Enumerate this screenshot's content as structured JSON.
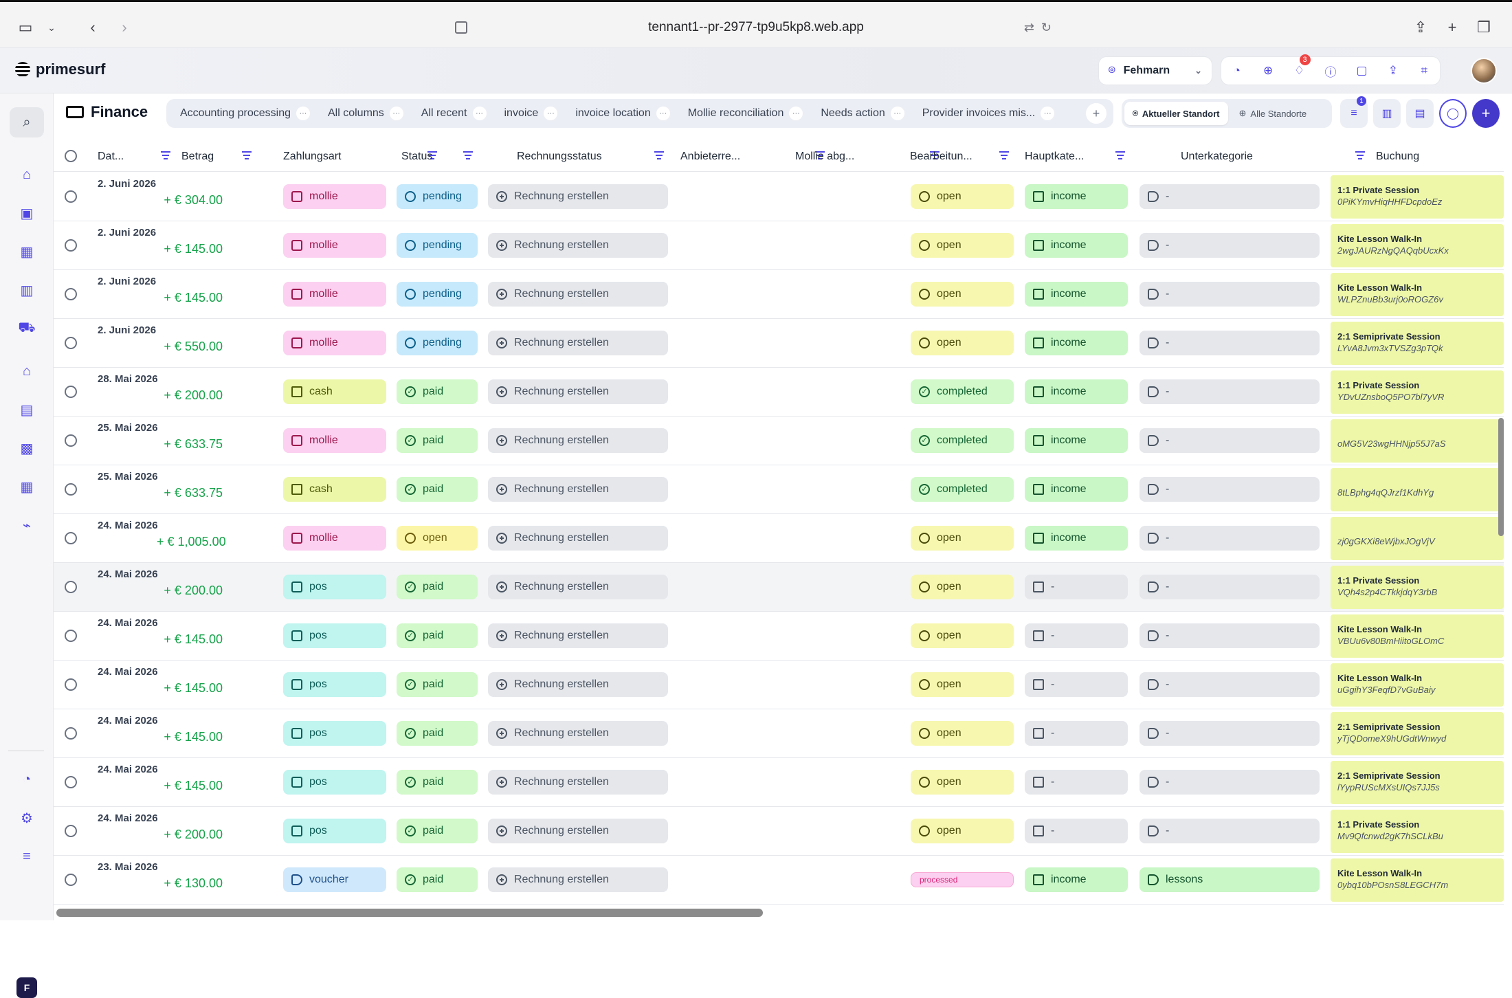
{
  "browser": {
    "url": "tennant1--pr-2977-tp9u5kp8.web.app"
  },
  "app": {
    "name": "primesurf",
    "location": "Fehmarn",
    "notifications": "3"
  },
  "page": {
    "title": "Finance"
  },
  "tabs": [
    "Accounting processing",
    "All columns",
    "All recent",
    "invoice",
    "invoice location",
    "Mollie reconciliation",
    "Needs action",
    "Provider invoices mis..."
  ],
  "scope": {
    "current": "Aktueller Standort",
    "all": "Alle Standorte"
  },
  "filter_badge": "1",
  "columns": {
    "date": "Dat...",
    "amount": "Betrag",
    "payment": "Zahlungsart",
    "status": "Status",
    "invoice": "Rechnungsstatus",
    "provider": "Anbieterre...",
    "mollie": "Mollie abg...",
    "processing": "Bearbeitun...",
    "main_category": "Hauptkate...",
    "sub_category": "Unterkategorie",
    "booking": "Buchung"
  },
  "rows": [
    {
      "date": "2. Juni 2026",
      "amount": "+ € 304.00",
      "payment": "mollie",
      "status": "pending",
      "invoice": "Rechnung erstellen",
      "processing": "open",
      "main": "income",
      "sub": "-",
      "booking": "1:1 Private Session",
      "code": "0PiKYmvHiqHHFDcpdoEz"
    },
    {
      "date": "2. Juni 2026",
      "amount": "+ € 145.00",
      "payment": "mollie",
      "status": "pending",
      "invoice": "Rechnung erstellen",
      "processing": "open",
      "main": "income",
      "sub": "-",
      "booking": "Kite Lesson Walk-In",
      "code": "2wgJAURzNgQAQqbUcxKx"
    },
    {
      "date": "2. Juni 2026",
      "amount": "+ € 145.00",
      "payment": "mollie",
      "status": "pending",
      "invoice": "Rechnung erstellen",
      "processing": "open",
      "main": "income",
      "sub": "-",
      "booking": "Kite Lesson Walk-In",
      "code": "WLPZnuBb3urj0oROGZ6v"
    },
    {
      "date": "2. Juni 2026",
      "amount": "+ € 550.00",
      "payment": "mollie",
      "status": "pending",
      "invoice": "Rechnung erstellen",
      "processing": "open",
      "main": "income",
      "sub": "-",
      "booking": "2:1 Semiprivate Session",
      "code": "LYvA8Jvm3xTVSZg3pTQk"
    },
    {
      "date": "28. Mai 2026",
      "amount": "+ € 200.00",
      "payment": "cash",
      "status": "paid",
      "invoice": "Rechnung erstellen",
      "processing": "completed",
      "main": "income",
      "sub": "-",
      "booking": "1:1 Private Session",
      "code": "YDvUZnsboQ5PO7bl7yVR"
    },
    {
      "date": "25. Mai 2026",
      "amount": "+ € 633.75",
      "payment": "mollie",
      "status": "paid",
      "invoice": "Rechnung erstellen",
      "processing": "completed",
      "main": "income",
      "sub": "-",
      "booking": "",
      "code": "oMG5V23wgHHNjp55J7aS"
    },
    {
      "date": "25. Mai 2026",
      "amount": "+ € 633.75",
      "payment": "cash",
      "status": "paid",
      "invoice": "Rechnung erstellen",
      "processing": "completed",
      "main": "income",
      "sub": "-",
      "booking": "",
      "code": "8tLBphg4qQJrzf1KdhYg"
    },
    {
      "date": "24. Mai 2026",
      "amount": "+ € 1,005.00",
      "payment": "mollie",
      "status": "open",
      "invoice": "Rechnung erstellen",
      "processing": "open",
      "main": "income",
      "sub": "-",
      "booking": "",
      "code": "zj0gGKXi8eWjbxJOgVjV"
    },
    {
      "date": "24. Mai 2026",
      "amount": "+ € 200.00",
      "payment": "pos",
      "status": "paid",
      "invoice": "Rechnung erstellen",
      "processing": "open",
      "main": "-",
      "sub": "-",
      "booking": "1:1 Private Session",
      "code": "VQh4s2p4CTkkjdqY3rbB"
    },
    {
      "date": "24. Mai 2026",
      "amount": "+ € 145.00",
      "payment": "pos",
      "status": "paid",
      "invoice": "Rechnung erstellen",
      "processing": "open",
      "main": "-",
      "sub": "-",
      "booking": "Kite Lesson Walk-In",
      "code": "VBUu6v80BmHiitoGLOmC"
    },
    {
      "date": "24. Mai 2026",
      "amount": "+ € 145.00",
      "payment": "pos",
      "status": "paid",
      "invoice": "Rechnung erstellen",
      "processing": "open",
      "main": "-",
      "sub": "-",
      "booking": "Kite Lesson Walk-In",
      "code": "uGgihY3FeqfD7vGuBaiy"
    },
    {
      "date": "24. Mai 2026",
      "amount": "+ € 145.00",
      "payment": "pos",
      "status": "paid",
      "invoice": "Rechnung erstellen",
      "processing": "open",
      "main": "-",
      "sub": "-",
      "booking": "2:1 Semiprivate Session",
      "code": "yTjQDomeX9hUGdtWnwyd"
    },
    {
      "date": "24. Mai 2026",
      "amount": "+ € 145.00",
      "payment": "pos",
      "status": "paid",
      "invoice": "Rechnung erstellen",
      "processing": "open",
      "main": "-",
      "sub": "-",
      "booking": "2:1 Semiprivate Session",
      "code": "lYypRUScMXsUIQs7JJ5s"
    },
    {
      "date": "24. Mai 2026",
      "amount": "+ € 200.00",
      "payment": "pos",
      "status": "paid",
      "invoice": "Rechnung erstellen",
      "processing": "open",
      "main": "-",
      "sub": "-",
      "booking": "1:1 Private Session",
      "code": "Mv9Qfcnwd2gK7hSCLkBu"
    },
    {
      "date": "23. Mai 2026",
      "amount": "+ € 130.00",
      "payment": "voucher",
      "status": "paid",
      "invoice": "Rechnung erstellen",
      "processing": "processed",
      "main": "income",
      "sub": "lessons",
      "booking": "Kite Lesson Walk-In",
      "code": "0ybq10bPOsnS8LEGCH7m"
    }
  ]
}
